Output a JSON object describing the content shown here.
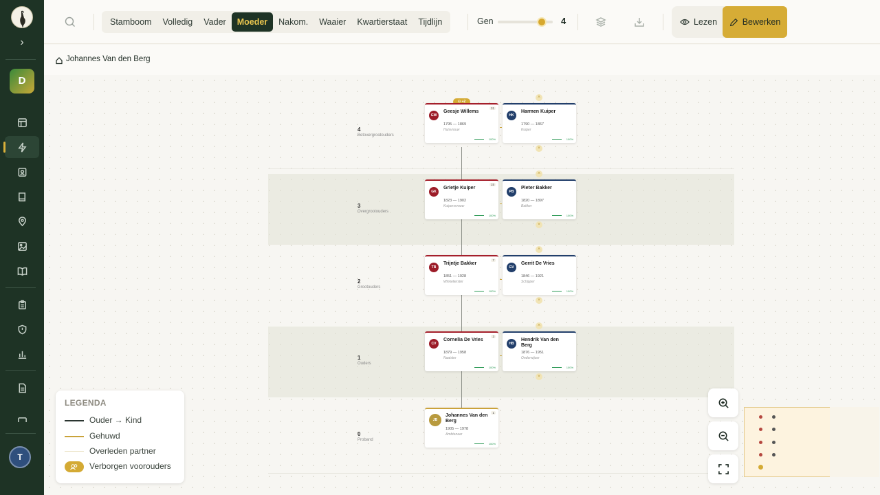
{
  "sidebar": {
    "workspace_initial": "D",
    "user_initial": "T",
    "items": [
      {
        "name": "dashboard-icon"
      },
      {
        "name": "bolt-icon"
      },
      {
        "name": "contacts-icon"
      },
      {
        "name": "book-icon"
      },
      {
        "name": "location-pin-icon"
      },
      {
        "name": "image-icon"
      },
      {
        "name": "open-book-icon"
      },
      {
        "name": "clipboard-icon"
      },
      {
        "name": "shield-icon"
      },
      {
        "name": "bar-chart-icon"
      },
      {
        "name": "document-icon"
      }
    ]
  },
  "toolbar": {
    "views": [
      "Stamboom",
      "Volledig",
      "Vader",
      "Moeder",
      "Nakom.",
      "Waaier",
      "Kwartierstaat",
      "Tijdlijn"
    ],
    "active_view": "Moeder",
    "gen_label": "Gen",
    "gen_value": "4",
    "gen_max": 5,
    "read_label": "Lezen",
    "edit_label": "Bewerken"
  },
  "breadcrumb": {
    "person": "Johannes Van den Berg"
  },
  "generations": [
    {
      "num": "4",
      "name": "Betovergrootouders"
    },
    {
      "num": "3",
      "name": "Overgrootouders"
    },
    {
      "num": "2",
      "name": "Grootouders"
    },
    {
      "num": "1",
      "name": "Ouders"
    },
    {
      "num": "0",
      "name": "Proband"
    }
  ],
  "hidden_badge": "+2",
  "persons": [
    {
      "initials": "GW",
      "name": "Geesje Willems",
      "dates": "1795 — 1869",
      "occupation": "Huisvrouw",
      "count": "31",
      "progress": "100%",
      "sex": "female"
    },
    {
      "initials": "HK",
      "name": "Harmen Kuiper",
      "dates": "1790 — 1867",
      "occupation": "Kuiper",
      "count": "",
      "progress": "100%",
      "sex": "male"
    },
    {
      "initials": "GK",
      "name": "Grietje Kuiper",
      "dates": "1823 — 1902",
      "occupation": "Kuipersvrouw",
      "count": "15",
      "progress": "100%",
      "sex": "female"
    },
    {
      "initials": "PB",
      "name": "Pieter Bakker",
      "dates": "1820 — 1897",
      "occupation": "Bakker",
      "count": "",
      "progress": "100%",
      "sex": "male"
    },
    {
      "initials": "TB",
      "name": "Trijntje Bakker",
      "dates": "1851 — 1928",
      "occupation": "Winkelierster",
      "count": "7",
      "progress": "100%",
      "sex": "female"
    },
    {
      "initials": "GV",
      "name": "Gerrit De Vries",
      "dates": "1846 — 1921",
      "occupation": "Schipper",
      "count": "",
      "progress": "100%",
      "sex": "male"
    },
    {
      "initials": "CV",
      "name": "Cornelia De Vries",
      "dates": "1879 — 1958",
      "occupation": "Naaister",
      "count": "3",
      "progress": "100%",
      "sex": "female"
    },
    {
      "initials": "HB",
      "name": "Hendrik Van den Berg",
      "dates": "1876 — 1951",
      "occupation": "Onderwijzer",
      "count": "",
      "progress": "100%",
      "sex": "male"
    },
    {
      "initials": "JB",
      "name": "Johannes Van den Berg",
      "dates": "1905 — 1978",
      "occupation": "Ambtenaar",
      "count": "1",
      "progress": "100%",
      "sex": "root"
    }
  ],
  "legend": {
    "title": "LEGENDA",
    "items": [
      {
        "label": "Ouder → Kind",
        "color": "#2a3530"
      },
      {
        "label": "Gehuwd",
        "color": "#c9a33a"
      },
      {
        "label": "Overleden partner",
        "color": "#ece4c8"
      },
      {
        "label": "Verborgen voorouders",
        "color": "#d4aa34"
      }
    ]
  },
  "colors": {
    "sidebar": "#1e3325",
    "accent": "#d6ac36",
    "female": "#a51f2b",
    "male": "#223f6b",
    "progress": "#2d9a56"
  }
}
